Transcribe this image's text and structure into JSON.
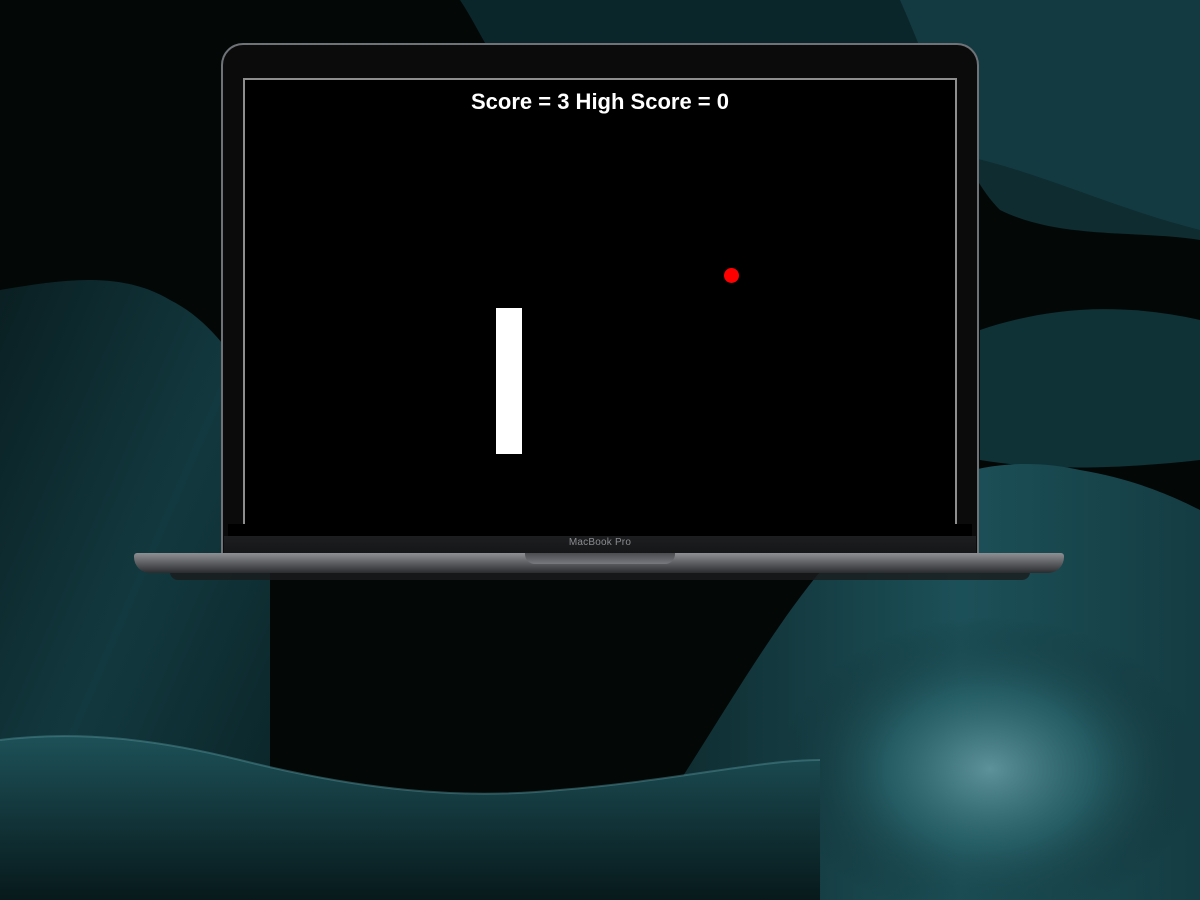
{
  "wallpaper": {
    "base_color": "#030807",
    "wave_color": "#1f5660",
    "highlight_color": "#6a9ea6"
  },
  "laptop": {
    "brand_label": "MacBook Pro"
  },
  "game": {
    "score_label": "Score = ",
    "score": 3,
    "high_score_label": " High Score = ",
    "high_score": 0,
    "background": "#000000",
    "paddle_color": "#ffffff",
    "ball_color": "#ff0000"
  }
}
